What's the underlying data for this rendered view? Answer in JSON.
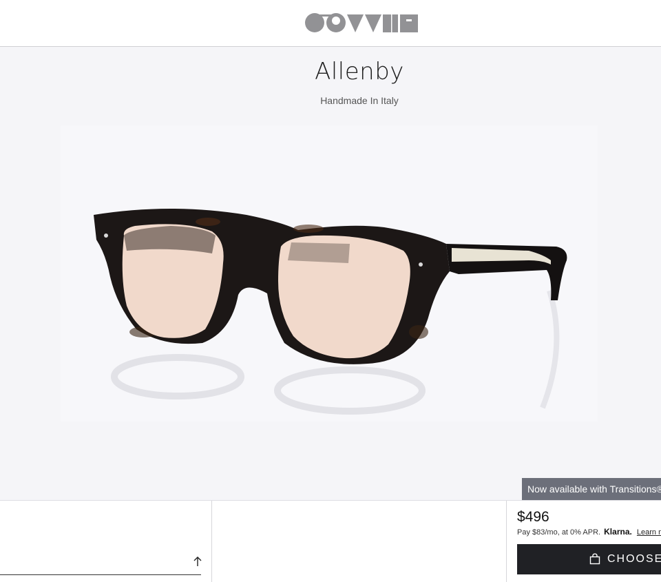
{
  "header": {
    "logo_icon": "oliver-peoples-logo"
  },
  "product": {
    "name": "Allenby",
    "subtitle": "Handmade In Italy"
  },
  "badge": {
    "text": "Now available with Transitions®"
  },
  "purchase": {
    "price": "$496",
    "installment": "Pay $83/mo, at 0% APR.",
    "provider": "Klarna.",
    "learn_more": "Learn m",
    "cta_label": "CHOOSE Y",
    "cta_icon": "shopping-bag-icon"
  },
  "scroll_top_icon": "arrow-up-icon",
  "colors": {
    "cta_bg": "#202125",
    "badge_bg": "#6c6f7a",
    "lens_tint": "#f1d9cb"
  }
}
